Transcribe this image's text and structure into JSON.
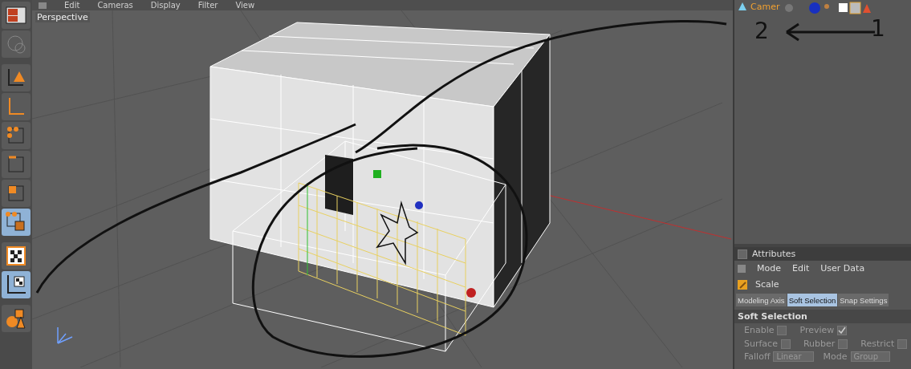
{
  "toolbar": [
    {
      "kind": "layout",
      "selected": false
    },
    {
      "kind": "globe",
      "selected": false
    },
    {
      "kind": "object-axis",
      "selected": false
    },
    {
      "kind": "axis",
      "selected": false
    },
    {
      "kind": "points",
      "selected": false
    },
    {
      "kind": "edges",
      "selected": false
    },
    {
      "kind": "polygons",
      "selected": false
    },
    {
      "kind": "soft",
      "selected": true
    },
    {
      "kind": "checker",
      "selected": false
    },
    {
      "kind": "texture-axis",
      "selected": true
    },
    {
      "kind": "primitives",
      "selected": false
    }
  ],
  "viewport": {
    "menu": [
      "Edit",
      "Cameras",
      "Display",
      "Filter",
      "View"
    ],
    "label": "Perspective"
  },
  "object_manager": {
    "object": "Camer"
  },
  "annotations": [
    {
      "text": "2"
    },
    {
      "text": "1"
    }
  ],
  "attributes": {
    "title": "Attributes",
    "menu": [
      "Mode",
      "Edit",
      "User Data"
    ],
    "tool": "Scale",
    "tabs": [
      {
        "label": "Modeling Axis",
        "selected": false
      },
      {
        "label": "Soft Selection",
        "selected": true
      },
      {
        "label": "Snap Settings",
        "selected": false
      }
    ],
    "section": "Soft Selection",
    "rows": [
      [
        {
          "label": "Enable",
          "checked": false
        },
        {
          "label": "Preview",
          "checked": true
        }
      ],
      [
        {
          "label": "Surface",
          "checked": false
        },
        {
          "label": "Rubber",
          "checked": false
        },
        {
          "label": "Restrict",
          "checked": false
        }
      ]
    ],
    "falloff": {
      "label": "Falloff",
      "value": "Linear"
    },
    "mode": {
      "label": "Mode",
      "value": "Group"
    }
  }
}
